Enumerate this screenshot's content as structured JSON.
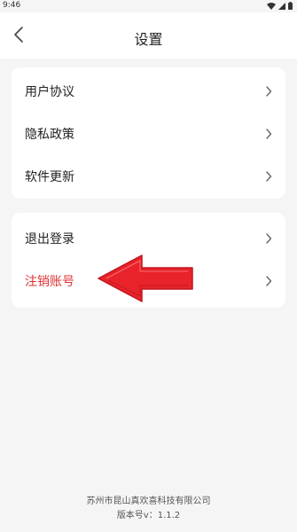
{
  "status_bar": {
    "time": "9:46"
  },
  "header": {
    "title": "设置"
  },
  "group1": {
    "items": [
      {
        "label": "用户协议"
      },
      {
        "label": "隐私政策"
      },
      {
        "label": "软件更新"
      }
    ]
  },
  "group2": {
    "items": [
      {
        "label": "退出登录"
      },
      {
        "label": "注销账号"
      }
    ]
  },
  "footer": {
    "company": "苏州市昆山真欢喜科技有限公司",
    "version": "版本号v：1.1.2"
  },
  "colors": {
    "danger": "#e03131",
    "arrow": "#e8232a"
  }
}
